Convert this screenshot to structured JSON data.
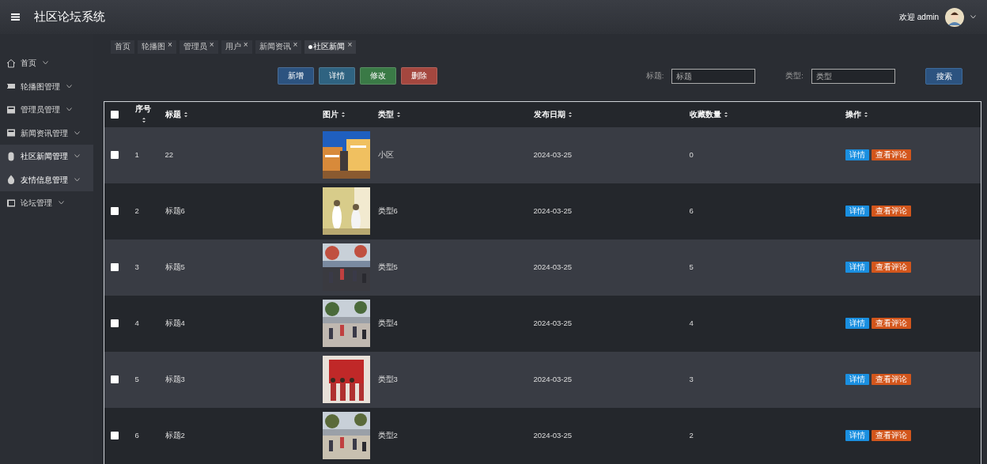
{
  "header": {
    "title": "社区论坛系统",
    "welcome": "欢迎 admin"
  },
  "sidebar": {
    "items": [
      {
        "label": "首页",
        "selected": false
      },
      {
        "label": "轮播图管理",
        "selected": false
      },
      {
        "label": "管理员管理",
        "selected": false
      },
      {
        "label": "新闻资讯管理",
        "selected": false
      },
      {
        "label": "社区新闻管理",
        "selected": true
      },
      {
        "label": "友情信息管理",
        "selected": true
      },
      {
        "label": "论坛管理",
        "selected": false
      }
    ]
  },
  "tabs": [
    {
      "label": "首页",
      "closable": false,
      "selected": false
    },
    {
      "label": "轮播图",
      "closable": true,
      "selected": false
    },
    {
      "label": "管理员",
      "closable": true,
      "selected": false
    },
    {
      "label": "用户",
      "closable": true,
      "selected": false
    },
    {
      "label": "新闻资讯",
      "closable": true,
      "selected": false
    },
    {
      "label": "社区新闻",
      "closable": true,
      "selected": true
    }
  ],
  "close_mark": "×",
  "actions": [
    {
      "label": "新增",
      "kind": "add"
    },
    {
      "label": "详情",
      "kind": "info"
    },
    {
      "label": "修改",
      "kind": "edit"
    },
    {
      "label": "删除",
      "kind": "delete"
    }
  ],
  "search": {
    "fields": [
      {
        "label": "标题:",
        "placeholder": "标题"
      },
      {
        "label": "类型:",
        "placeholder": "类型"
      }
    ],
    "button": "搜索"
  },
  "table": {
    "select_all_checked": false,
    "columns": [
      "序号",
      "标题",
      "图片",
      "类型",
      "发布日期",
      "收藏数量",
      "操作"
    ],
    "rows": [
      {
        "checked": false,
        "cells": [
          "1",
          "22",
          "",
          "小区",
          "2024-03-25",
          "0"
        ],
        "picture": {
          "kind": "picture"
        },
        "buttons": [
          "详情",
          "查看评论"
        ]
      },
      {
        "checked": false,
        "cells": [
          "2",
          "标题6",
          "",
          "类型6",
          "2024-03-25",
          "6"
        ],
        "picture": {
          "kind": "picture"
        },
        "buttons": [
          "详情",
          "查看评论"
        ]
      },
      {
        "checked": false,
        "cells": [
          "3",
          "标题5",
          "",
          "类型5",
          "2024-03-25",
          "5"
        ],
        "picture": {
          "kind": "picture"
        },
        "buttons": [
          "详情",
          "查看评论"
        ]
      },
      {
        "checked": false,
        "cells": [
          "4",
          "标题4",
          "",
          "类型4",
          "2024-03-25",
          "4"
        ],
        "picture": {
          "kind": "picture"
        },
        "buttons": [
          "详情",
          "查看评论"
        ]
      },
      {
        "checked": false,
        "cells": [
          "5",
          "标题3",
          "",
          "类型3",
          "2024-03-25",
          "3"
        ],
        "picture": {
          "kind": "picture"
        },
        "buttons": [
          "详情",
          "查看评论"
        ]
      },
      {
        "checked": false,
        "cells": [
          "6",
          "标题2",
          "",
          "类型2",
          "2024-03-25",
          "2"
        ],
        "picture": {
          "kind": "picture"
        },
        "buttons": [
          "详情",
          "查看评论"
        ]
      }
    ]
  }
}
